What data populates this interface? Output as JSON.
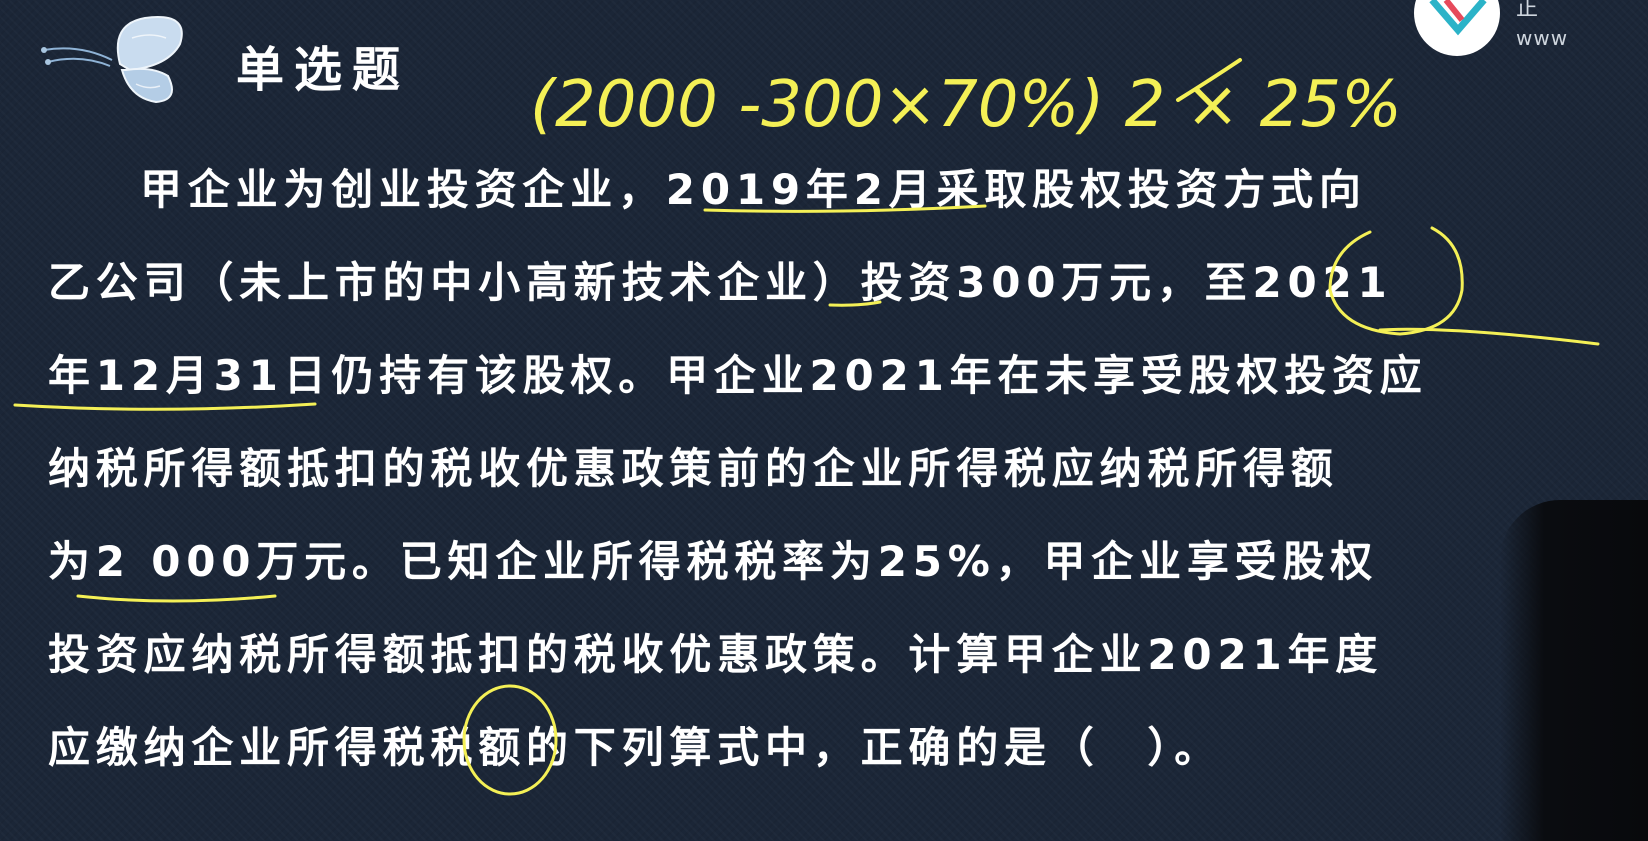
{
  "slide": {
    "title": "单选题",
    "question_lines": [
      "甲企业为创业投资企业，2019年2月采取股权投资方式向",
      "乙公司（未上市的中小高新技术企业）投资300万元，至2021",
      "年12月31日仍持有该股权。甲企业2021年在未享受股权投资应",
      "纳税所得额抵扣的税收优惠政策前的企业所得税应纳税所得额",
      "为2 000万元。已知企业所得税税率为25%，甲企业享受股权",
      "投资应纳税所得额抵扣的税收优惠政策。计算甲企业2021年度",
      "应缴纳企业所得税税额的下列算式中，正确的是（　）。"
    ]
  },
  "handwriting": {
    "formula": "(2000 -300×70%) 2 × 25%"
  },
  "branding": {
    "url_text": "www",
    "url_top_text": "正"
  },
  "colors": {
    "background": "#1b2637",
    "text": "#ffffff",
    "ink": "#f4f056"
  },
  "icons": {
    "decoration": "butterfly-icon",
    "logo": "brand-logo-icon"
  }
}
